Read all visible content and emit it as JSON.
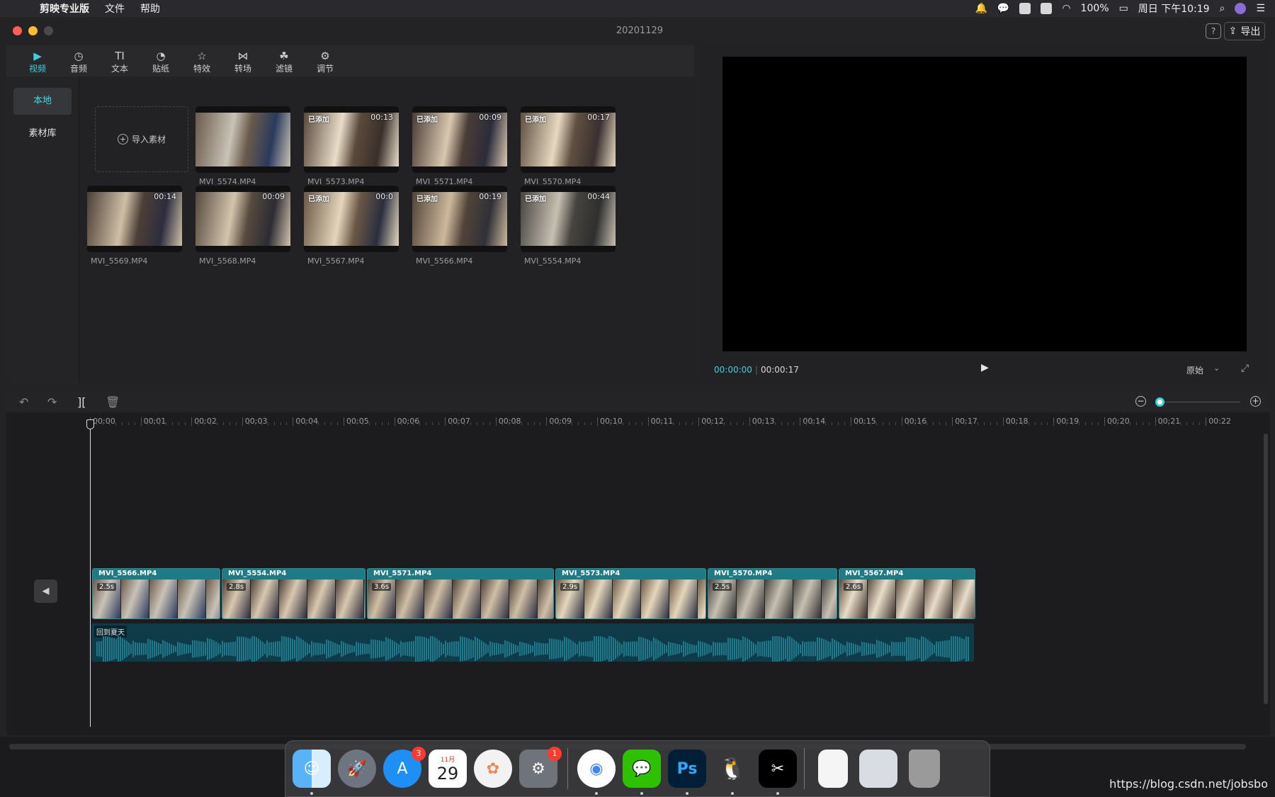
{
  "menubar": {
    "app_name": "剪映专业版",
    "menus": [
      "文件",
      "帮助"
    ],
    "battery": "100%",
    "clock": "周日 下午10:19"
  },
  "window": {
    "title": "20201129",
    "help_label": "?",
    "export_label": "导出"
  },
  "tool_tabs": [
    {
      "label": "视频",
      "icon": "video-icon"
    },
    {
      "label": "音频",
      "icon": "audio-icon"
    },
    {
      "label": "文本",
      "icon": "text-icon"
    },
    {
      "label": "贴纸",
      "icon": "sticker-icon"
    },
    {
      "label": "特效",
      "icon": "effects-icon"
    },
    {
      "label": "转场",
      "icon": "transition-icon"
    },
    {
      "label": "滤镜",
      "icon": "filter-icon"
    },
    {
      "label": "调节",
      "icon": "adjust-icon"
    }
  ],
  "sidebar": {
    "items": [
      {
        "label": "本地",
        "active": true
      },
      {
        "label": "素材库",
        "active": false
      }
    ]
  },
  "media": {
    "import_label": "导入素材",
    "added_badge": "已添加",
    "items": [
      {
        "name": "MVI_5574.MP4",
        "duration": "",
        "added": false
      },
      {
        "name": "MVI_5573.MP4",
        "duration": "00:13",
        "added": true
      },
      {
        "name": "MVI_5571.MP4",
        "duration": "00:09",
        "added": true
      },
      {
        "name": "MVI_5570.MP4",
        "duration": "00:17",
        "added": true
      },
      {
        "name": "MVI_5569.MP4",
        "duration": "00:14",
        "added": false
      },
      {
        "name": "MVI_5568.MP4",
        "duration": "00:09",
        "added": false
      },
      {
        "name": "MVI_5567.MP4",
        "duration": "00:0",
        "added": true
      },
      {
        "name": "MVI_5566.MP4",
        "duration": "00:19",
        "added": true
      },
      {
        "name": "MVI_5554.MP4",
        "duration": "00:44",
        "added": true
      }
    ]
  },
  "player": {
    "current_time": "00:00:00",
    "total_time": "00:00:17",
    "ratio_label": "原始"
  },
  "timeline": {
    "ruler": [
      "00:00",
      "00:01",
      "00:02",
      "00:03",
      "00:04",
      "00:05",
      "00:06",
      "00:07",
      "00:08",
      "00:09",
      "00:10",
      "00:11",
      "00:12",
      "00:13",
      "00:14",
      "00:15",
      "00:16",
      "00:17",
      "00:18",
      "00:19",
      "00:20",
      "00:21",
      "00:22"
    ],
    "clips": [
      {
        "name": "MVI_5566.MP4",
        "duration": "2.5s"
      },
      {
        "name": "MVI_5554.MP4",
        "duration": "2.8s"
      },
      {
        "name": "MVI_5571.MP4",
        "duration": "3.6s"
      },
      {
        "name": "MVI_5573.MP4",
        "duration": "2.9s"
      },
      {
        "name": "MVI_5570.MP4",
        "duration": "2.5s"
      },
      {
        "name": "MVI_5567.MP4",
        "duration": "2.6s"
      }
    ],
    "music_name": "回到夏天"
  },
  "dock": {
    "appstore_badge": "3",
    "calendar_month": "11月",
    "calendar_day": "29",
    "settings_badge": "1",
    "ps_label": "Ps"
  },
  "watermark": "https://blog.csdn.net/jobsbo",
  "colors": {
    "accent": "#3fd0df",
    "clip": "#1e7a83",
    "music": "#0f3b48"
  }
}
